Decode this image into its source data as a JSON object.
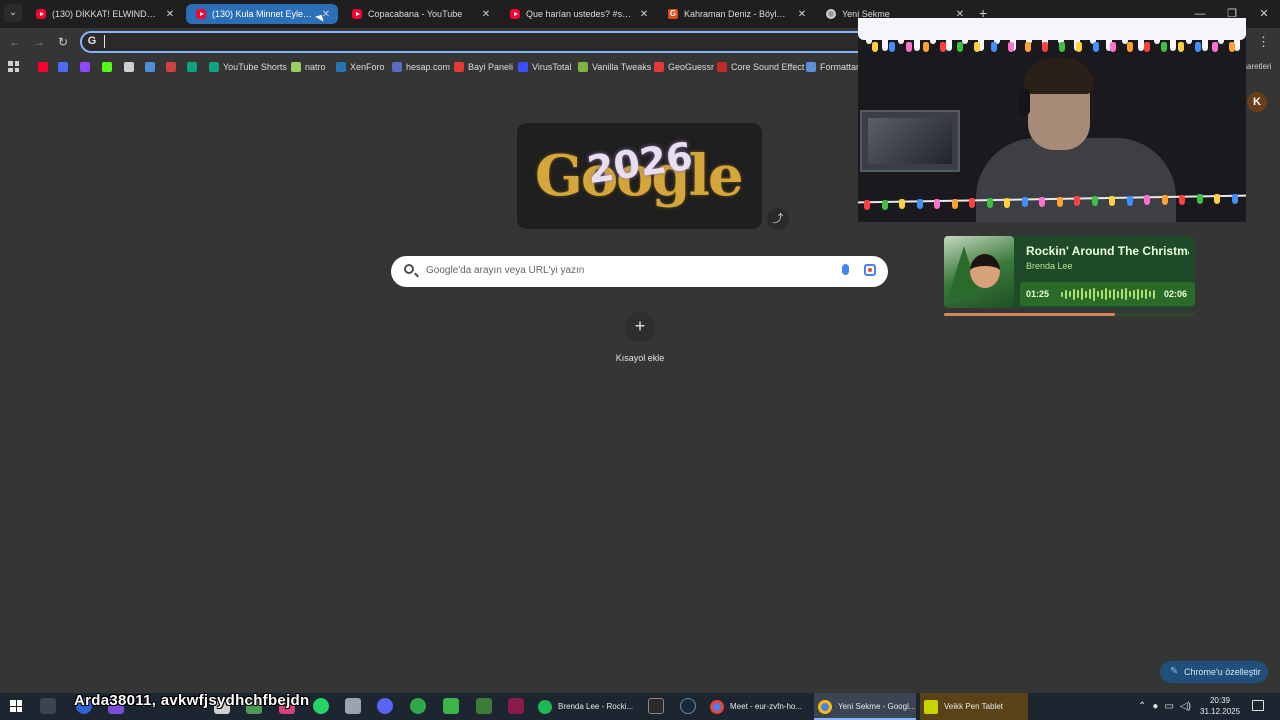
{
  "browser": {
    "tabs": [
      {
        "title": "(130) DİKKAT! ELWIND VE KLAN",
        "icon": "youtube-icon"
      },
      {
        "title": "(130) Kula Minnet Eylemem...",
        "icon": "youtube-icon"
      },
      {
        "title": "Copacabana - YouTube",
        "icon": "youtube-icon"
      },
      {
        "title": "Que harían ustedes? #shortvide",
        "icon": "youtube-icon"
      },
      {
        "title": "Kahraman Deniz - Böyle Sever",
        "icon": "genius-icon"
      },
      {
        "title": "Yeni Sekme",
        "icon": "chrome-icon"
      }
    ],
    "close_glyph": "✕",
    "new_tab_glyph": "+",
    "omnibox_icon_letter": "G",
    "bookmarks": [
      {
        "label": "",
        "color": "#ff0033"
      },
      {
        "label": "",
        "color": "#4a6cf7"
      },
      {
        "label": "",
        "color": "#9146ff"
      },
      {
        "label": "",
        "color": "#53fc18"
      },
      {
        "label": "",
        "color": "#cfcfcf"
      },
      {
        "label": "",
        "color": "#4a90d9"
      },
      {
        "label": "",
        "color": "#d04040"
      },
      {
        "label": "",
        "color": "#0fa37f"
      },
      {
        "label": "YouTube Shorts",
        "color": "#0fa37f"
      },
      {
        "label": "natro",
        "color": "#9ccc65"
      },
      {
        "label": "XenForo",
        "color": "#2577b1"
      },
      {
        "label": "hesap.com",
        "color": "#5c6bc0"
      },
      {
        "label": "Bayi Paneli",
        "color": "#e53935"
      },
      {
        "label": "VirusTotal",
        "color": "#394eff"
      },
      {
        "label": "Vanilla Tweaks",
        "color": "#7cb342"
      },
      {
        "label": "GeoGuessr",
        "color": "#e53935"
      },
      {
        "label": "Core Sound Effect",
        "color": "#c62828"
      },
      {
        "label": "Formattan",
        "color": "#5c8fd6"
      }
    ],
    "bookmarks_right_label": "şaretleri",
    "profile_letter": "K"
  },
  "newtab": {
    "doodle_text": "Google",
    "doodle_year": "2026",
    "search_placeholder": "Google'da arayın veya URL'yi yazın",
    "add_glyph": "+",
    "shortcut_label": "Kısayol ekle",
    "customize_label": "Chrome'u özelleştir"
  },
  "now_playing": {
    "title": "Rockin' Around The Christmas",
    "artist": "Brenda Lee",
    "elapsed": "01:25",
    "duration": "02:06",
    "progress": 0.68
  },
  "taskbar": {
    "overlay_text": "Arda38011, avkwfjsydhchfbejdn",
    "items": [
      {
        "label": "Brenda Lee - Rocki...",
        "color": "#1db954"
      },
      {
        "label": "Meet - eur-zvfn-ho...",
        "color": "#4285f4"
      },
      {
        "label": "Yeni Sekme - Googl...",
        "color": "#4285f4"
      },
      {
        "label": "Veikk Pen Tablet",
        "color": "#c8d400"
      }
    ],
    "clock_time": "20:39",
    "clock_date": "31.12.2025"
  }
}
